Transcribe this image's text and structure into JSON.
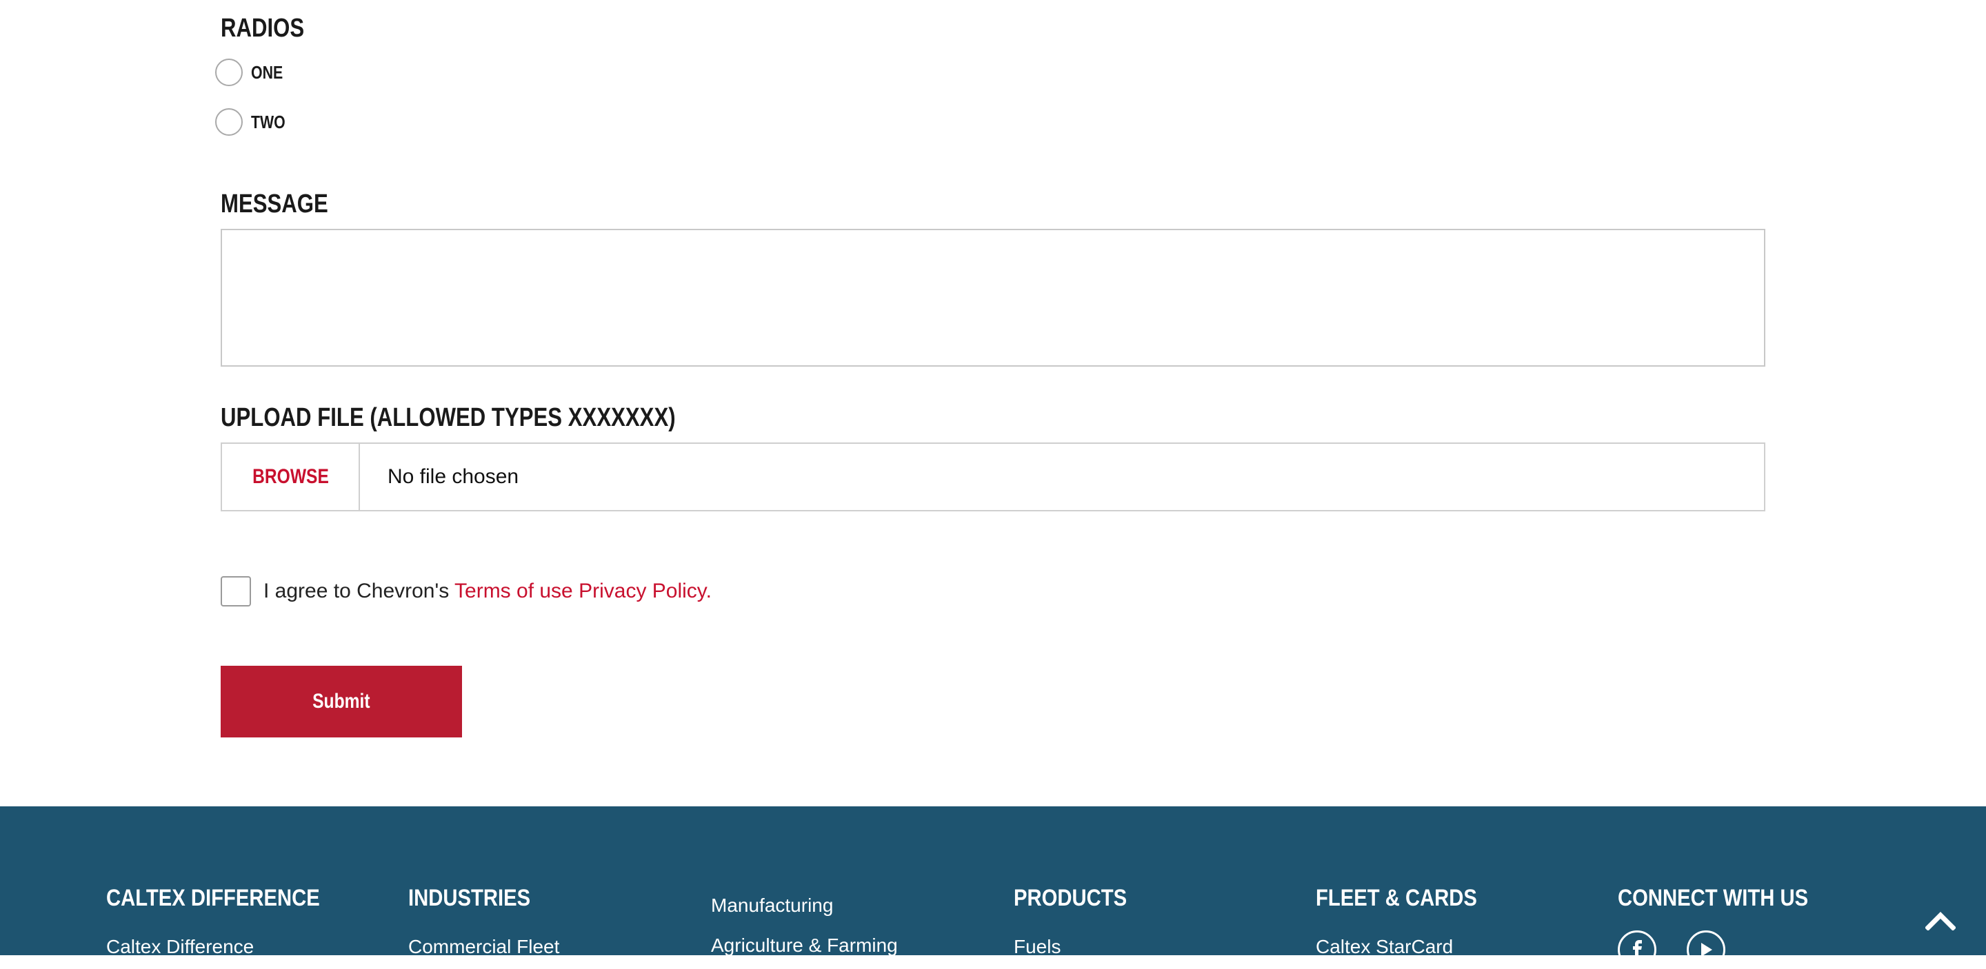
{
  "form": {
    "radios": {
      "heading": "RADIOS",
      "options": [
        {
          "label": "ONE",
          "checked": false
        },
        {
          "label": "TWO",
          "checked": false
        }
      ]
    },
    "message": {
      "heading": "MESSAGE",
      "value": ""
    },
    "upload": {
      "heading": "UPLOAD FILE (ALLOWED TYPES XXXXXXX)",
      "browse_label": "BROWSE",
      "status": "No file chosen"
    },
    "agree": {
      "checked": false,
      "text": "I agree to Chevron's",
      "terms_link": "Terms of use",
      "privacy_link": "Privacy Policy."
    },
    "submit_label": "Submit"
  },
  "footer": {
    "columns": [
      {
        "heading": "CALTEX DIFFERENCE",
        "links": [
          "Caltex Difference"
        ]
      },
      {
        "heading": "INDUSTRIES",
        "links": [
          "Commercial Fleet"
        ]
      },
      {
        "heading": "",
        "links": [
          "Manufacturing",
          "Agriculture & Farming"
        ]
      },
      {
        "heading": "PRODUCTS",
        "links": [
          "Fuels"
        ]
      },
      {
        "heading": "FLEET & CARDS",
        "links": [
          "Caltex StarCard"
        ]
      },
      {
        "heading": "CONNECT WITH US",
        "links": []
      }
    ],
    "social_icons": [
      "facebook-icon",
      "youtube-icon"
    ]
  },
  "colors": {
    "accent_red": "#c8102e",
    "submit_red": "#b91c31",
    "footer_bg": "#1e5470"
  }
}
